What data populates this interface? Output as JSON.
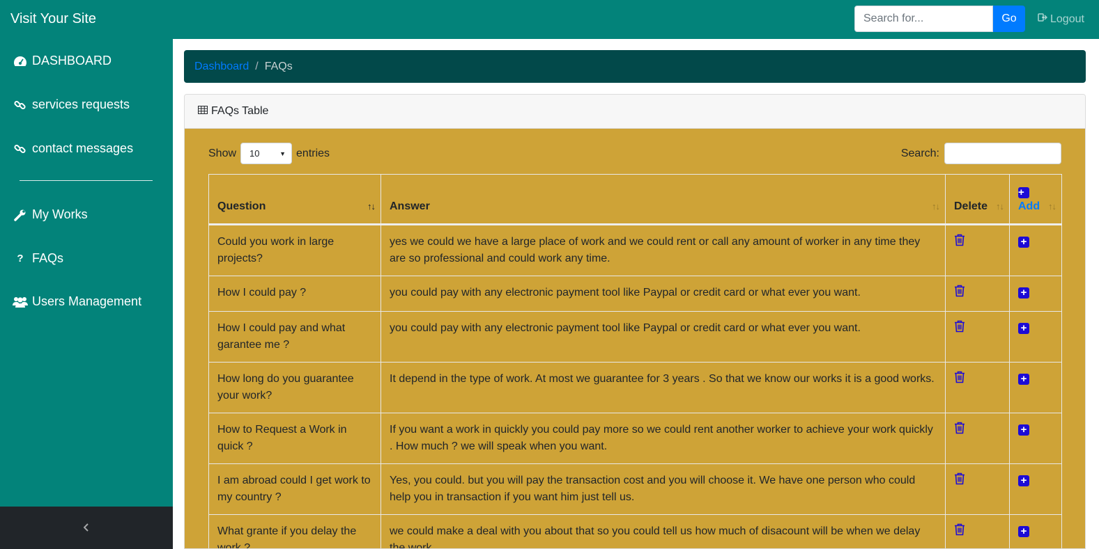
{
  "navbar": {
    "brand": "Visit Your Site",
    "search_placeholder": "Search for...",
    "go_label": "Go",
    "logout_label": "Logout"
  },
  "sidebar": {
    "items": [
      {
        "label": "DASHBOARD",
        "icon": "dashboard-icon"
      },
      {
        "label": "services requests",
        "icon": "link-icon"
      },
      {
        "label": "contact messages",
        "icon": "link-icon"
      },
      {
        "label": "My Works",
        "icon": "wrench-icon"
      },
      {
        "label": "FAQs",
        "icon": "question-icon"
      },
      {
        "label": "Users Management",
        "icon": "users-icon"
      }
    ],
    "toggle_icon": "chevron-left-icon"
  },
  "breadcrumb": {
    "link": "Dashboard",
    "separator": "/",
    "current": "FAQs"
  },
  "card": {
    "title": "FAQs Table",
    "show_label": "Show",
    "entries_value": "10",
    "entries_label": "entries",
    "search_label": "Search:"
  },
  "table": {
    "headers": {
      "question": "Question",
      "answer": "Answer",
      "delete": "Delete",
      "add": "Add"
    },
    "rows": [
      {
        "question": "Could you work in large projects?",
        "answer": "yes we could we have a large place of work and we could rent or call any amount of worker in any time they are so professional and could work any time."
      },
      {
        "question": "How I could pay ?",
        "answer": "you could pay with any electronic payment tool like Paypal or credit card or what ever you want."
      },
      {
        "question": "How I could pay and what garantee me ?",
        "answer": "you could pay with any electronic payment tool like Paypal or credit card or what ever you want."
      },
      {
        "question": "How long do you guarantee your work?",
        "answer": "It depend in the type of work. At most we guarantee for 3 years . So that we know our works it is a good works."
      },
      {
        "question": "How to Request a Work in quick ?",
        "answer": "If you want a work in quickly you could pay more so we could rent another worker to achieve your work quickly . How much ? we will speak when you want."
      },
      {
        "question": "I am abroad could I get work to my country ?",
        "answer": "Yes, you could. but you will pay the transaction cost and you will choose it. We have one person who could help you in transaction if you want him just tell us."
      },
      {
        "question": "What grante if you delay the work ?",
        "answer": "we could make a deal with you about that so you could tell us how much of disacount will be when we delay the work."
      }
    ]
  },
  "colors": {
    "sidebar": "#03837a",
    "breadcrumb_bg": "#02494a",
    "card_body": "#cea337",
    "action_icons": "#1d0bd6",
    "link": "#007bff"
  }
}
